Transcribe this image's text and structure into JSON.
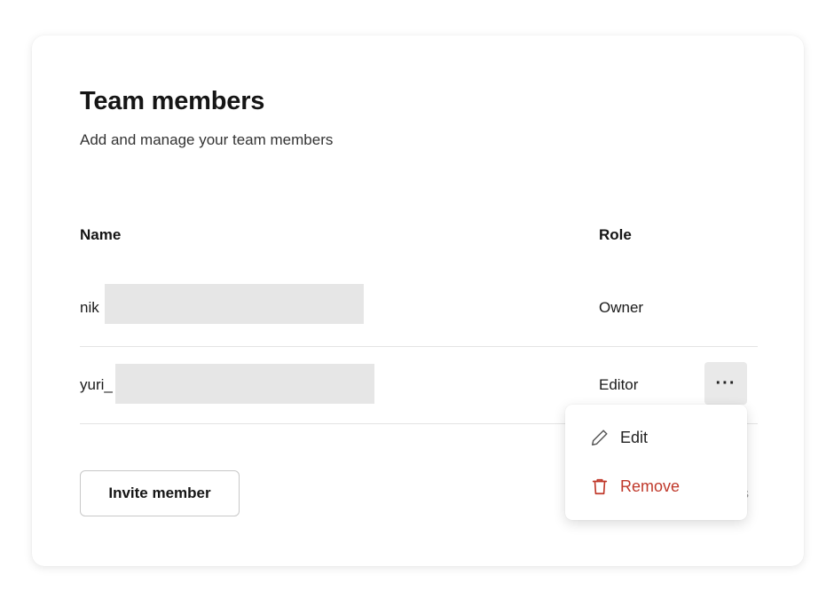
{
  "header": {
    "title": "Team members",
    "subtitle": "Add and manage your team members"
  },
  "table": {
    "columns": [
      "Name",
      "Role"
    ],
    "rows": [
      {
        "name": "nik",
        "role": "Owner"
      },
      {
        "name": "yuri_",
        "role": "Editor",
        "actions_label": "···"
      }
    ]
  },
  "actions_menu": {
    "items": [
      {
        "label": "Edit",
        "icon": "pencil-icon"
      },
      {
        "label": "Remove",
        "icon": "trash-icon",
        "color": "#c0392b"
      }
    ]
  },
  "footer": {
    "invite_label": "Invite member",
    "clipped_text": "s"
  }
}
